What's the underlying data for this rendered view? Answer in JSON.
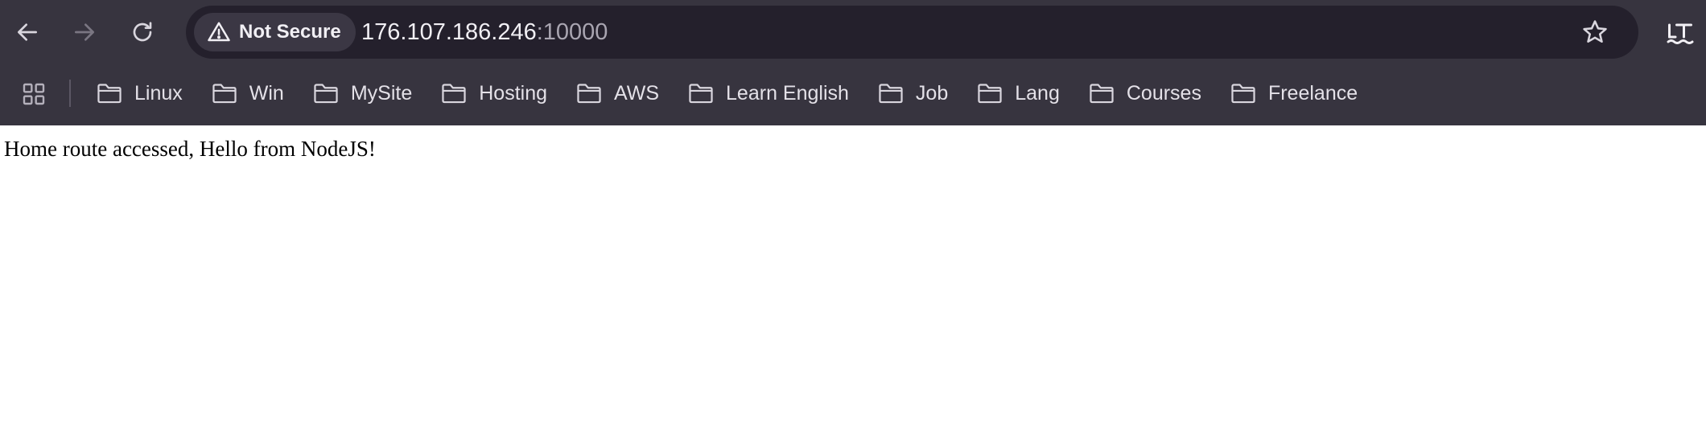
{
  "browser": {
    "nav": {
      "back": {
        "icon": "arrow-left-icon",
        "enabled": true
      },
      "forward": {
        "icon": "arrow-right-icon",
        "enabled": false
      },
      "reload": {
        "icon": "reload-icon"
      }
    },
    "omnibox": {
      "security_label": "Not Secure",
      "security_icon": "warning-triangle-icon",
      "url_host": "176.107.186.246",
      "url_port": ":10000",
      "bookmark_icon": "star-outline-icon"
    },
    "extension": {
      "icon": "language-tool-icon"
    },
    "bookmarks_bar": {
      "apps_icon": "apps-grid-icon",
      "items": [
        {
          "label": "Linux",
          "icon": "folder-icon"
        },
        {
          "label": "Win",
          "icon": "folder-icon"
        },
        {
          "label": "MySite",
          "icon": "folder-icon"
        },
        {
          "label": "Hosting",
          "icon": "folder-icon"
        },
        {
          "label": "AWS",
          "icon": "folder-icon"
        },
        {
          "label": "Learn English",
          "icon": "folder-icon"
        },
        {
          "label": "Job",
          "icon": "folder-icon"
        },
        {
          "label": "Lang",
          "icon": "folder-icon"
        },
        {
          "label": "Courses",
          "icon": "folder-icon"
        },
        {
          "label": "Freelance",
          "icon": "folder-icon"
        }
      ]
    }
  },
  "page": {
    "body_text": "Home route accessed, Hello from NodeJS!"
  },
  "colors": {
    "chrome_bg": "#37343f",
    "omnibox_bg": "#24202c",
    "chip_bg": "#3b3744",
    "text_light": "#e4e1e8",
    "text_dim": "#a9a5b1"
  }
}
